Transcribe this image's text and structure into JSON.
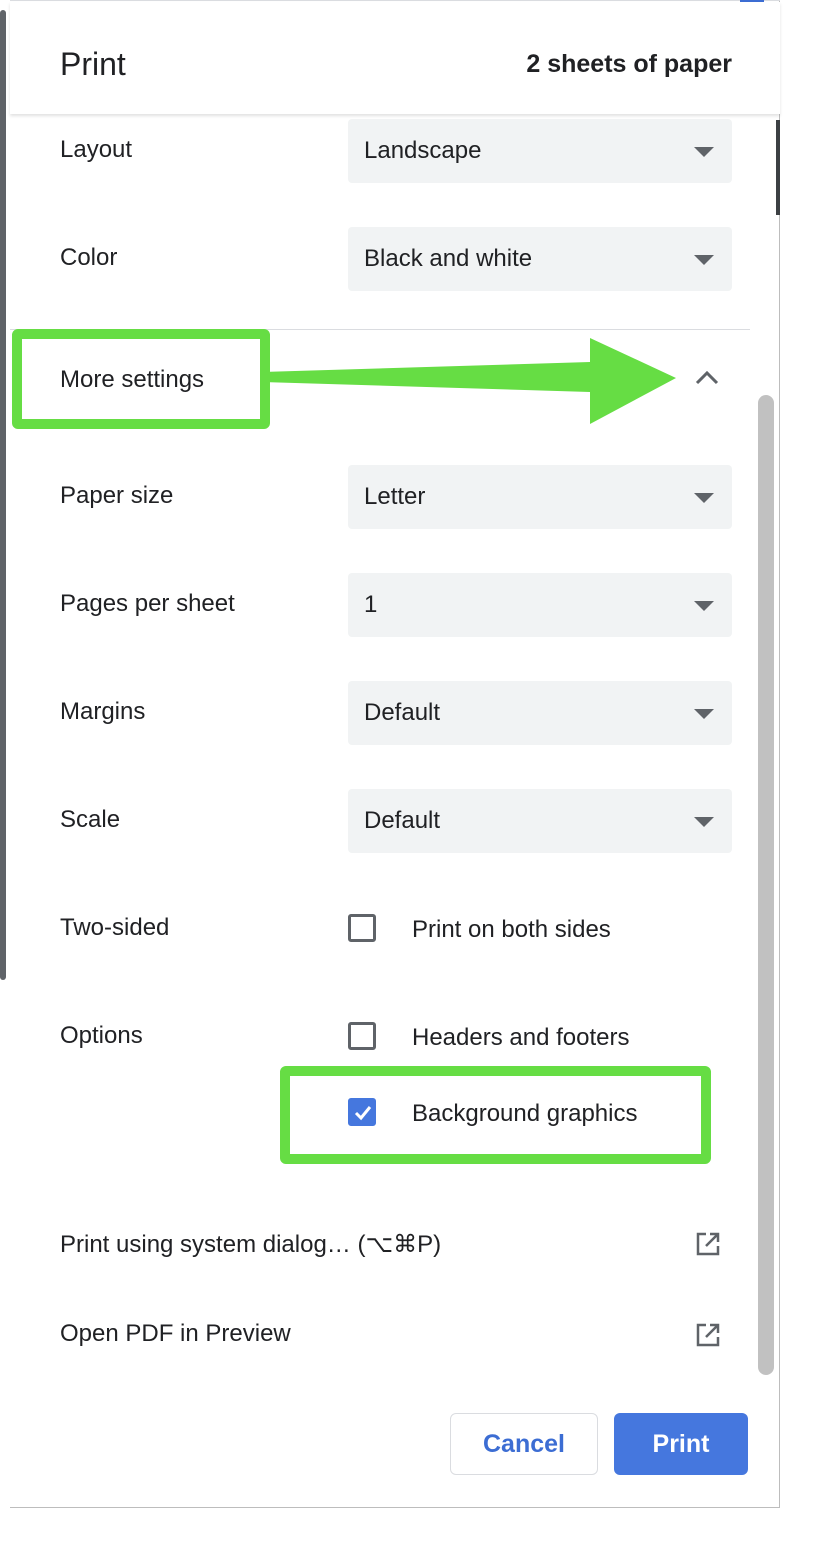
{
  "header": {
    "title": "Print",
    "sheets": "2 sheets of paper"
  },
  "settings": {
    "layout": {
      "label": "Layout",
      "value": "Landscape"
    },
    "color": {
      "label": "Color",
      "value": "Black and white"
    },
    "more_settings": {
      "label": "More settings"
    },
    "paper_size": {
      "label": "Paper size",
      "value": "Letter"
    },
    "pages_per_sheet": {
      "label": "Pages per sheet",
      "value": "1"
    },
    "margins": {
      "label": "Margins",
      "value": "Default"
    },
    "scale": {
      "label": "Scale",
      "value": "Default"
    },
    "two_sided": {
      "label": "Two-sided",
      "option": "Print on both sides",
      "checked": false
    },
    "options": {
      "label": "Options",
      "headers_footers": {
        "label": "Headers and footers",
        "checked": false
      },
      "background_graphics": {
        "label": "Background graphics",
        "checked": true
      }
    }
  },
  "links": {
    "system_dialog": "Print using system dialog… (⌥⌘P)",
    "open_pdf": "Open PDF in Preview"
  },
  "buttons": {
    "cancel": "Cancel",
    "print": "Print"
  },
  "colors": {
    "accent": "#4577de",
    "highlight": "#66dd44",
    "select_bg": "#f1f3f4"
  },
  "icons": {
    "dropdown": "caret-down-icon",
    "collapse": "chevron-up-icon",
    "external": "open-in-new-icon",
    "check": "checkmark-icon"
  }
}
